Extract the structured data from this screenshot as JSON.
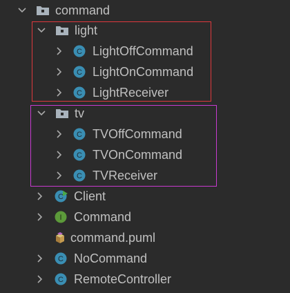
{
  "tree": {
    "root": {
      "label": "command",
      "icon": "package-folder-icon",
      "expanded": true
    },
    "light": {
      "label": "light",
      "icon": "package-folder-icon",
      "expanded": true,
      "items": [
        "LightOffCommand",
        "LightOnCommand",
        "LightReceiver"
      ]
    },
    "tv": {
      "label": "tv",
      "icon": "package-folder-icon",
      "expanded": true,
      "items": [
        "TVOffCommand",
        "TVOnCommand",
        "TVReceiver"
      ]
    },
    "others": {
      "client": {
        "label": "Client",
        "icon": "class-main-icon"
      },
      "command_iface": {
        "label": "Command",
        "icon": "interface-icon",
        "badge": "I"
      },
      "puml": {
        "label": "command.puml",
        "icon": "plantuml-file-icon"
      },
      "nocommand": {
        "label": "NoCommand",
        "icon": "class-icon"
      },
      "remote": {
        "label": "RemoteController",
        "icon": "class-icon"
      }
    },
    "class_badge": "C"
  },
  "colors": {
    "background": "#2b2b2b",
    "text": "#c0c0c0",
    "class_icon": "#3a8eb3",
    "interface_icon": "#5c9a3a",
    "folder_icon": "#a9b3bc",
    "highlight_red": "#e0393d",
    "highlight_purple": "#c93bd1"
  }
}
